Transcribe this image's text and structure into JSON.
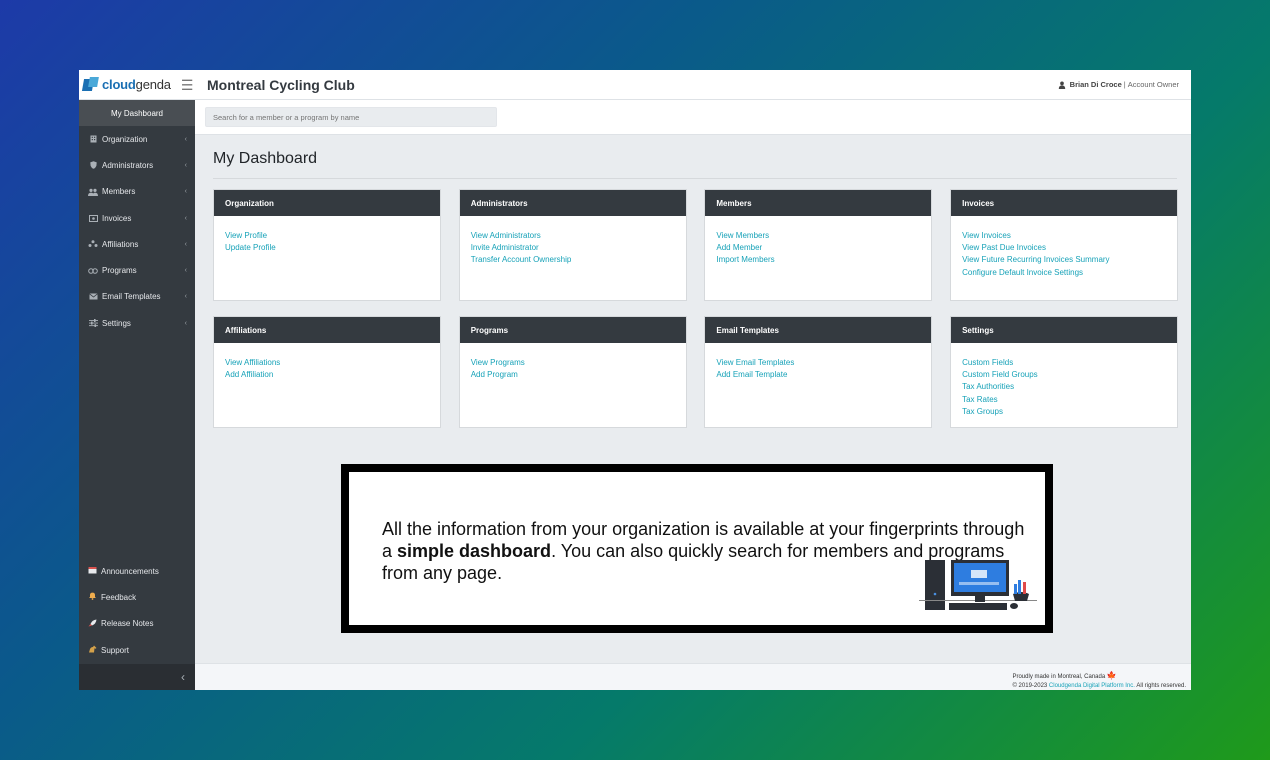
{
  "brand": {
    "name_bold": "cloud",
    "name_rest": "genda"
  },
  "header": {
    "club_name": "Montreal Cycling Club",
    "user_name": "Brian Di Croce",
    "user_role": "Account Owner"
  },
  "search": {
    "placeholder": "Search for a member or a program by name"
  },
  "sidebar": {
    "dashboard": "My Dashboard",
    "items": [
      {
        "label": "Organization",
        "icon": "building-icon"
      },
      {
        "label": "Administrators",
        "icon": "shield-icon"
      },
      {
        "label": "Members",
        "icon": "users-icon"
      },
      {
        "label": "Invoices",
        "icon": "invoice-icon"
      },
      {
        "label": "Affiliations",
        "icon": "affiliations-icon"
      },
      {
        "label": "Programs",
        "icon": "programs-icon"
      },
      {
        "label": "Email Templates",
        "icon": "envelope-icon"
      },
      {
        "label": "Settings",
        "icon": "sliders-icon"
      }
    ],
    "bottom_items": [
      {
        "label": "Announcements",
        "icon": "calendar-icon"
      },
      {
        "label": "Feedback",
        "icon": "bell-icon"
      },
      {
        "label": "Release Notes",
        "icon": "rocket-icon"
      },
      {
        "label": "Support",
        "icon": "horse-icon"
      }
    ]
  },
  "main": {
    "page_title": "My Dashboard",
    "cards": [
      {
        "title": "Organization",
        "links": [
          "View Profile",
          "Update Profile"
        ]
      },
      {
        "title": "Administrators",
        "links": [
          "View Administrators",
          "Invite Administrator",
          "Transfer Account Ownership"
        ]
      },
      {
        "title": "Members",
        "links": [
          "View Members",
          "Add Member",
          "Import Members"
        ]
      },
      {
        "title": "Invoices",
        "links": [
          "View Invoices",
          "View Past Due Invoices",
          "View Future Recurring Invoices Summary",
          "Configure Default Invoice Settings"
        ]
      },
      {
        "title": "Affiliations",
        "links": [
          "View Affiliations",
          "Add Affiliation"
        ]
      },
      {
        "title": "Programs",
        "links": [
          "View Programs",
          "Add Program"
        ]
      },
      {
        "title": "Email Templates",
        "links": [
          "View Email Templates",
          "Add Email Template"
        ]
      },
      {
        "title": "Settings",
        "links": [
          "Custom Fields",
          "Custom Field Groups",
          "Tax Authorities",
          "Tax Rates",
          "Tax Groups"
        ]
      }
    ]
  },
  "footer": {
    "line1": "Proudly made in Montreal, Canada",
    "line2_prefix": "© 2019-2023",
    "line2_link": "Cloudgenda Digital Platform Inc.",
    "line2_suffix": "All rights reserved."
  },
  "callout": {
    "text_before": "All the information from your organization is available at your fingerprints through a ",
    "text_bold": "simple dashboard",
    "text_after": ". You can also quickly search for members and programs from any page."
  },
  "colors": {
    "sidebar": "#343a40",
    "link": "#17a2b8",
    "card_header": "#343a40",
    "brand": "#1a6fb3"
  }
}
